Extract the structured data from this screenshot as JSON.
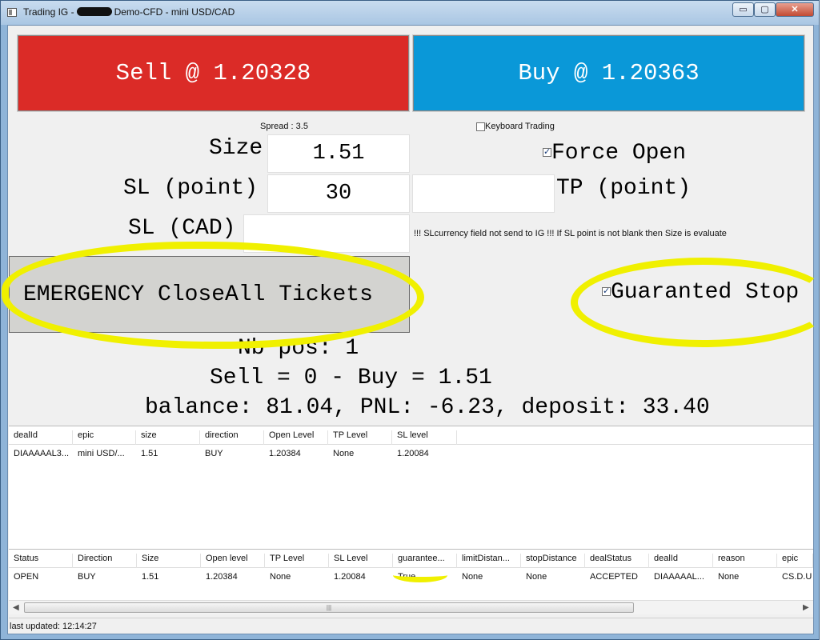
{
  "window": {
    "title_prefix": "Trading IG -",
    "title_suffix": "Demo-CFD - mini USD/CAD",
    "min_glyph": "▭",
    "max_glyph": "▢",
    "close_glyph": "✕"
  },
  "trade": {
    "sell_label": "Sell @ 1.20328",
    "buy_label": "Buy @ 1.20363",
    "sell_color": "#db2b27",
    "buy_color": "#0a98d8"
  },
  "form": {
    "spread_label": "Spread : 3.5",
    "keyboard_trading_label": "Keyboard Trading",
    "keyboard_trading_checked": false,
    "size_label": "Size",
    "size_value": "1.51",
    "force_open_label": "Force Open",
    "force_open_checked": true,
    "sl_point_label": "SL (point)",
    "sl_point_value": "30",
    "tp_point_label": "TP (point)",
    "tp_point_value": "",
    "sl_cad_label": "SL (CAD)",
    "sl_cad_value": "",
    "sl_note": "!!! SLcurrency field not send to IG !!! If SL point is not blank then Size is evaluate",
    "emergency_label": "EMERGENCY CloseAll Tickets",
    "guaranteed_stop_label": "Guaranted Stop",
    "guaranteed_stop_checked": true
  },
  "summary": {
    "nb_pos": "Nb pos: 1",
    "sell_buy": "Sell = 0 - Buy = 1.51",
    "balance": "balance: 81.04, PNL: -6.23, deposit: 33.40"
  },
  "positions": {
    "headers": [
      "dealId",
      "epic",
      "size",
      "direction",
      "Open Level",
      "TP Level",
      "SL level"
    ],
    "rows": [
      [
        "DIAAAAAL3...",
        "mini USD/...",
        "1.51",
        "BUY",
        "1.20384",
        "None",
        "1.20084"
      ]
    ]
  },
  "orders": {
    "headers": [
      "Status",
      "Direction",
      "Size",
      "Open level",
      "TP Level",
      "SL Level",
      "guarantee...",
      "limitDistan...",
      "stopDistance",
      "dealStatus",
      "dealId",
      "reason",
      "epic"
    ],
    "rows": [
      [
        "OPEN",
        "BUY",
        "1.51",
        "1.20384",
        "None",
        "1.20084",
        "True",
        "None",
        "None",
        "ACCEPTED",
        "DIAAAAAL...",
        "None",
        "CS.D.U"
      ]
    ]
  },
  "scrollbar": {
    "left_arrow": "◀",
    "right_arrow": "▶",
    "grip": "|||"
  },
  "status": {
    "last_updated": "last updated: 12:14:27"
  }
}
